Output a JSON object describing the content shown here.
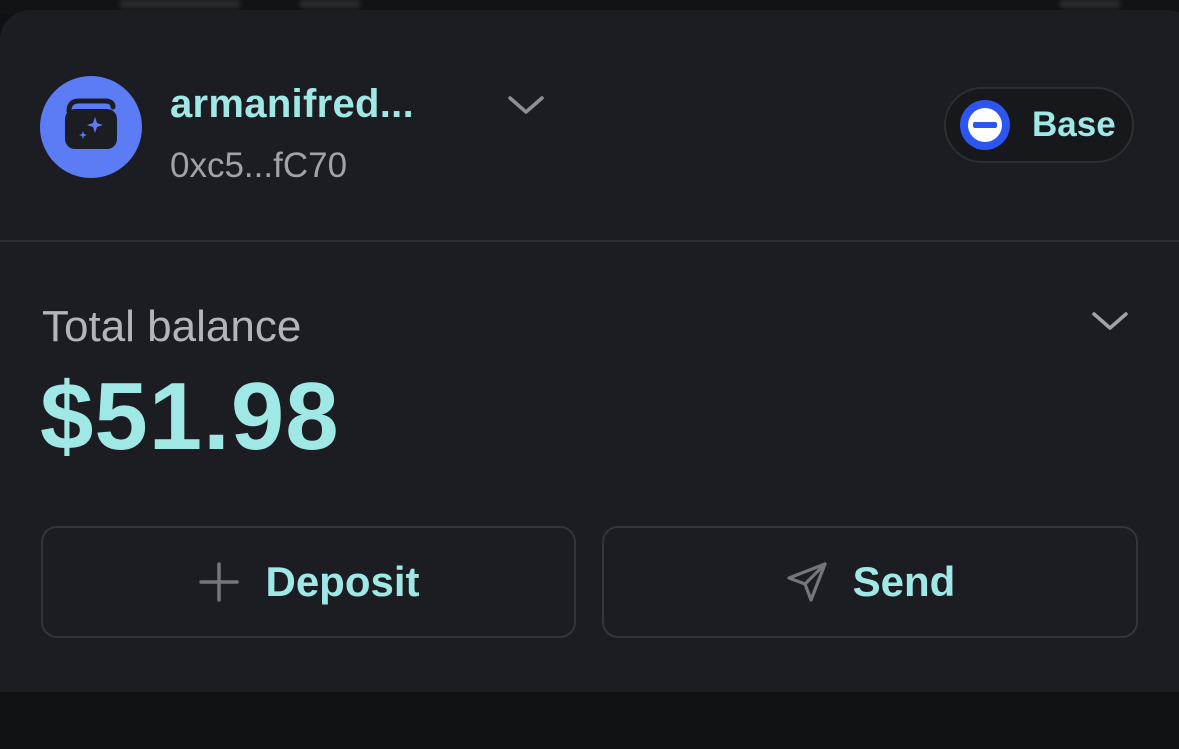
{
  "account": {
    "name": "armanifred...",
    "address": "0xc5...fC70",
    "avatar_icon": "wallet-sparkle-icon"
  },
  "network": {
    "label": "Base",
    "icon": "base-network-icon"
  },
  "balance": {
    "label": "Total balance",
    "value": "$51.98"
  },
  "actions": {
    "deposit_label": "Deposit",
    "send_label": "Send"
  },
  "colors": {
    "accent": "#9fe8e6",
    "card_background": "#1c1d22",
    "avatar": "#5b7cf5",
    "base_blue": "#2d55f0"
  }
}
